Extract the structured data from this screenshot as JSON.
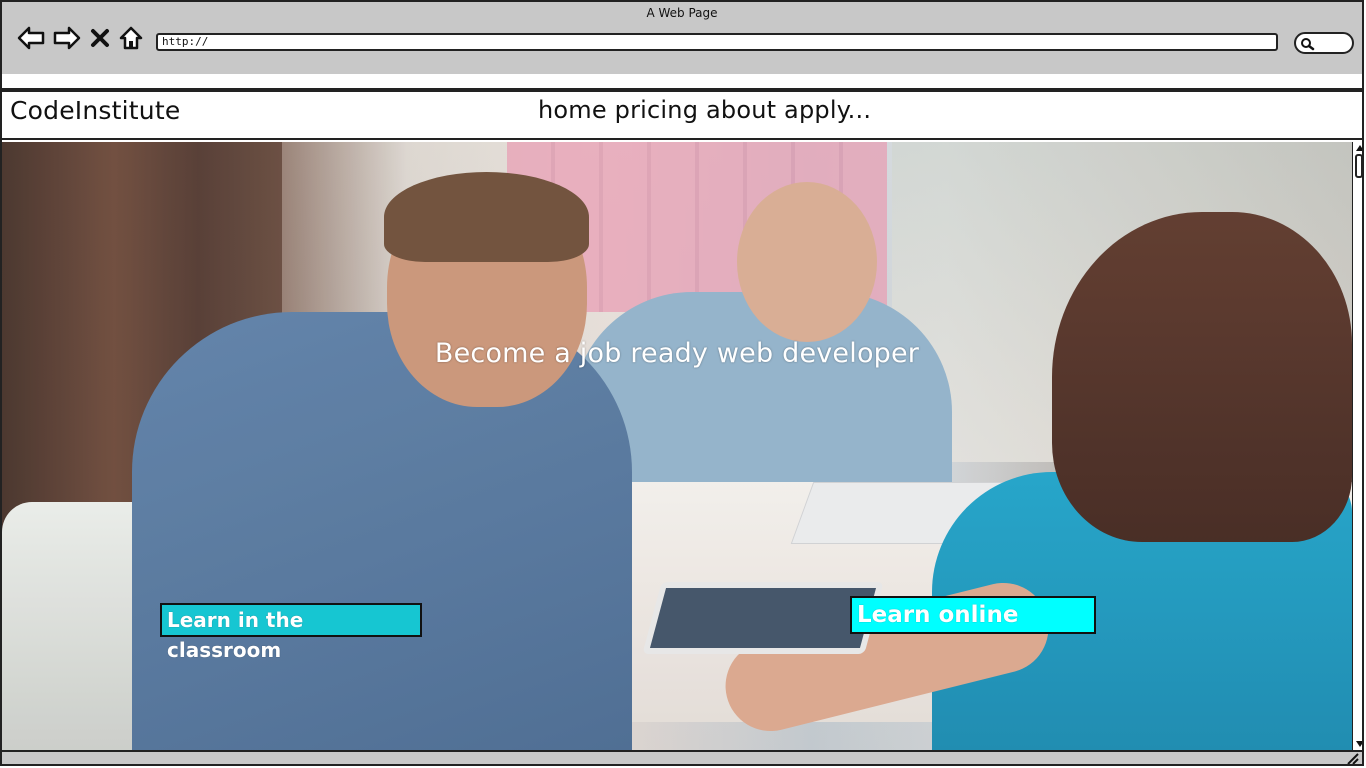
{
  "window": {
    "title": "A Web Page"
  },
  "browser": {
    "url": "http://",
    "icons": {
      "back": "arrow-left-icon",
      "forward": "arrow-right-icon",
      "stop": "close-icon",
      "home": "home-icon",
      "search": "search-icon"
    }
  },
  "header": {
    "brand": "CodeInstitute",
    "nav_text": "home pricing about apply..."
  },
  "hero": {
    "headline": "Become a job ready web developer",
    "cta_classroom": "Learn in the classroom",
    "cta_online": "Learn online",
    "image": "photo-team-meeting"
  },
  "colors": {
    "chrome": "#c8c8c8",
    "cta_online": "#00ffff",
    "cta_classroom": "#16c6d2",
    "outline": "#222222"
  }
}
